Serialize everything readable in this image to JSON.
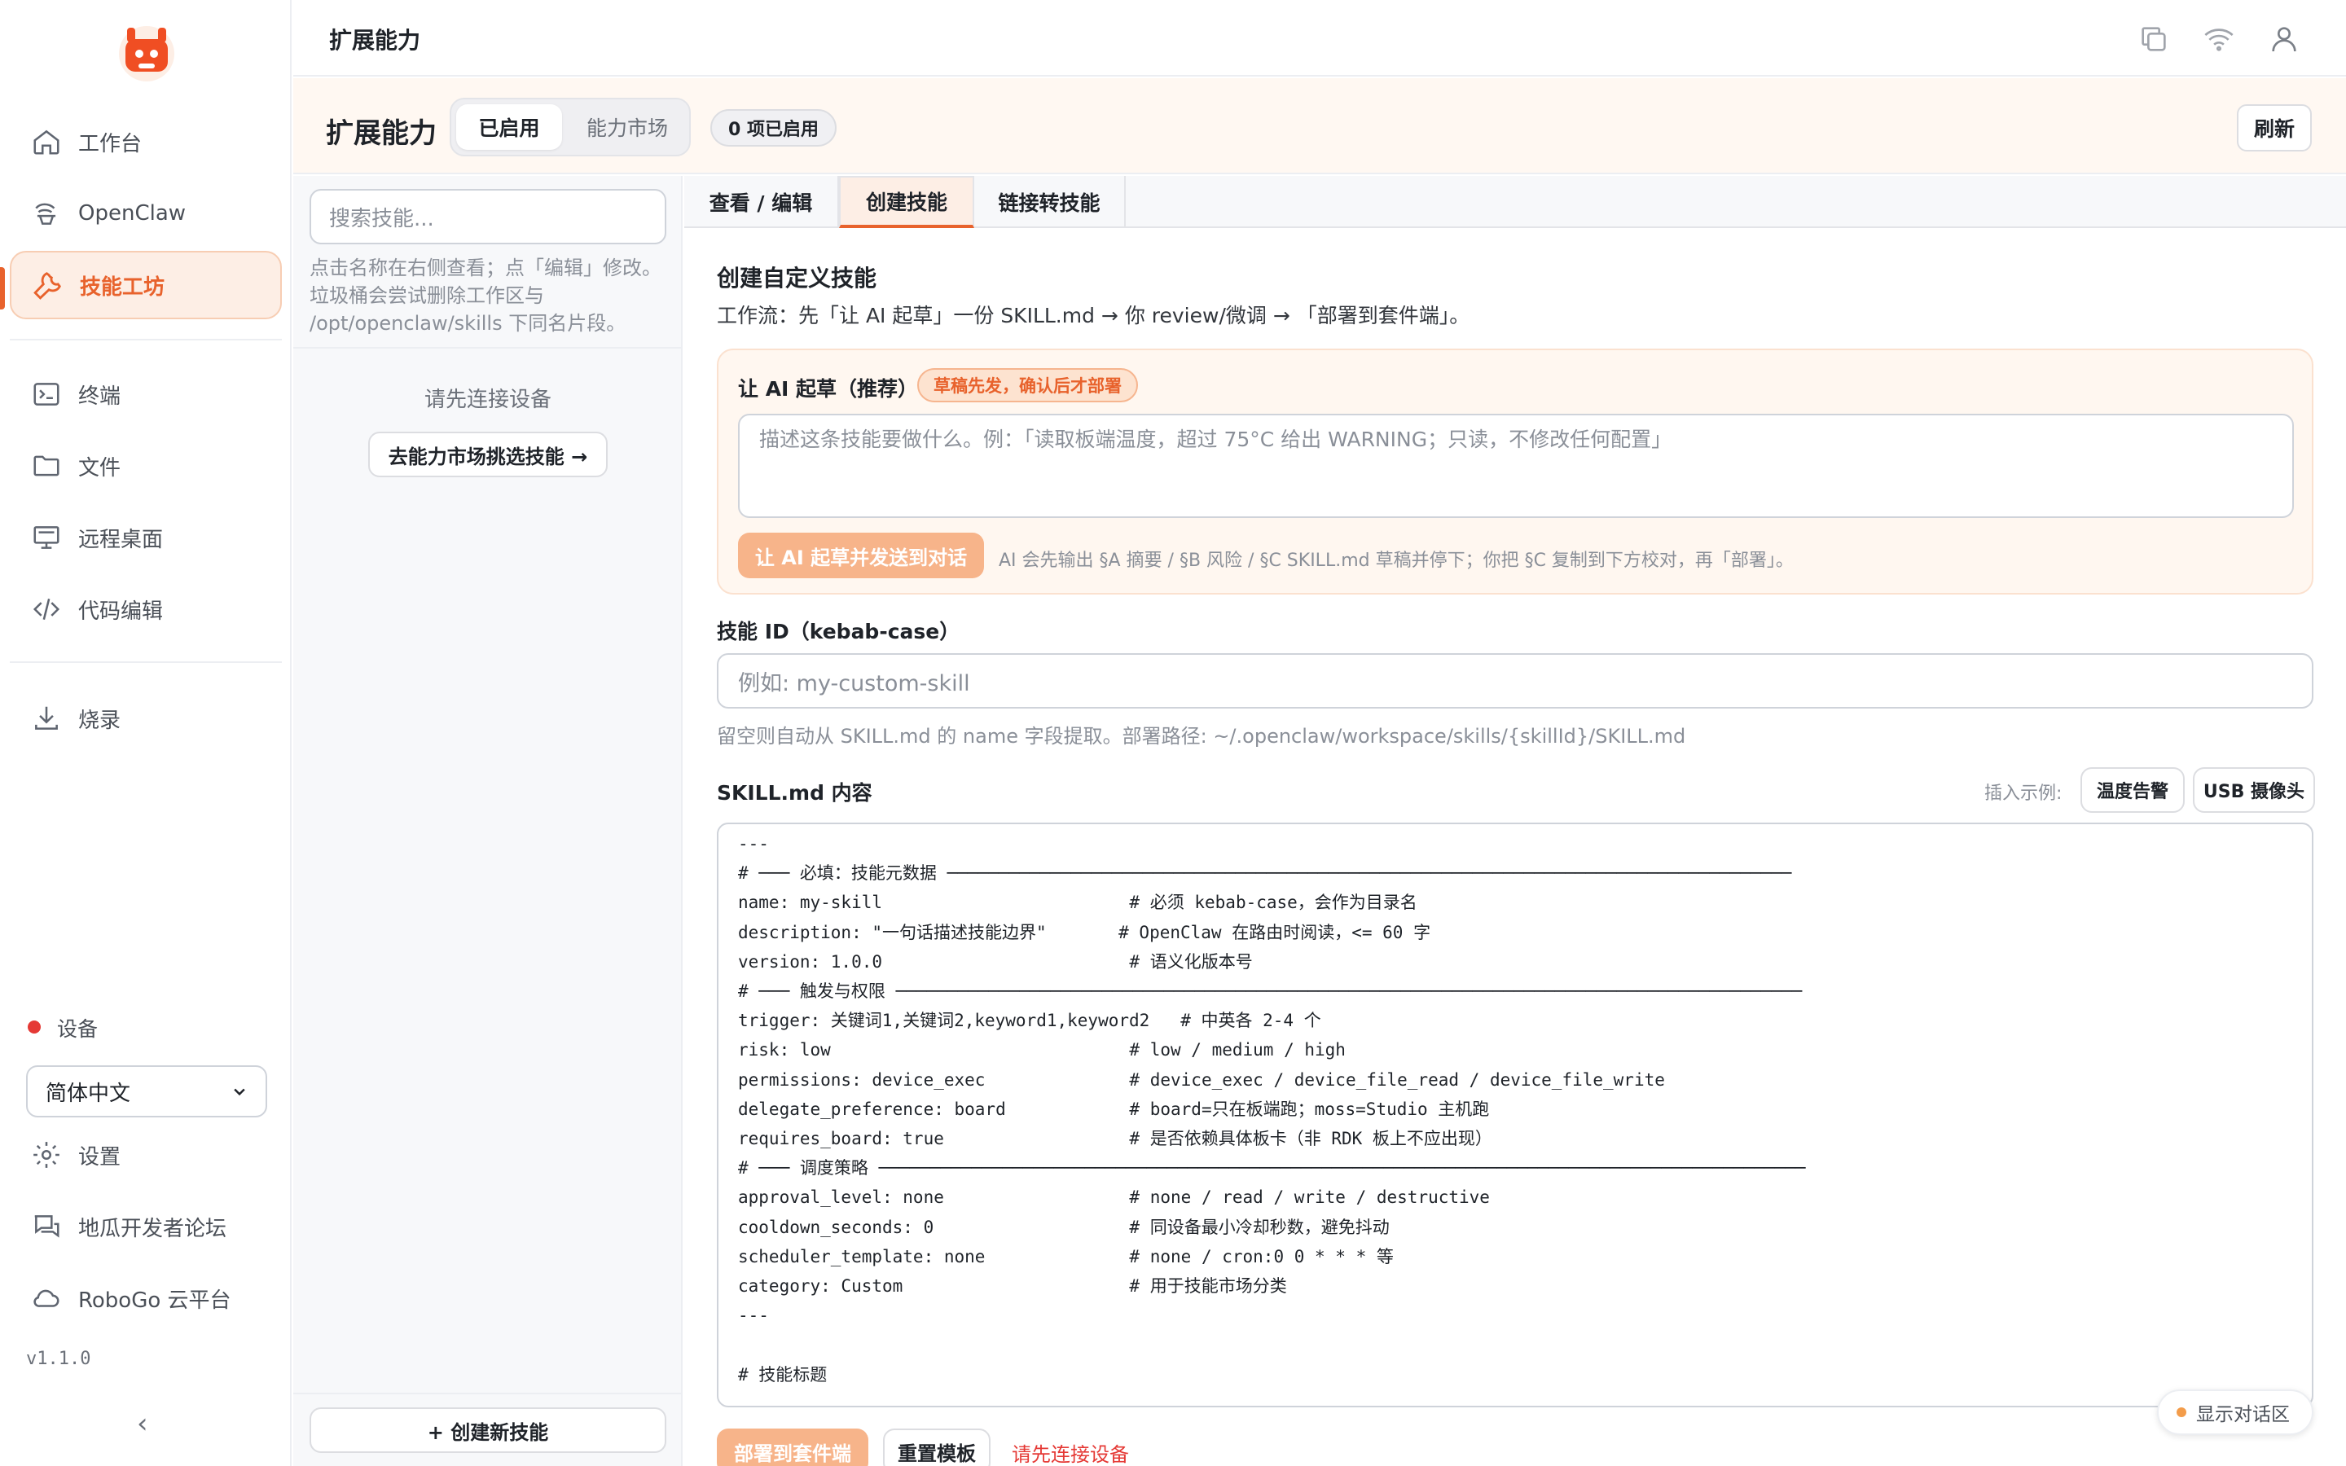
{
  "sidebar": {
    "nav": [
      "工作台",
      "OpenClaw",
      "技能工坊",
      "终端",
      "文件",
      "远程桌面",
      "代码编辑",
      "烧录"
    ],
    "device_label": "设备",
    "language": "简体中文",
    "bottom": [
      "设置",
      "地瓜开发者论坛",
      "RoboGo 云平台"
    ],
    "version": "v1.1.0"
  },
  "topbar": {
    "title": "扩展能力"
  },
  "page_header": {
    "title": "扩展能力",
    "tabs": [
      "已启用",
      "能力市场"
    ],
    "count_badge": "0 项已启用",
    "refresh_label": "刷新"
  },
  "skill_list": {
    "search_placeholder": "搜索技能...",
    "hint": "点击名称在右侧查看；点「编辑」修改。垃圾桶会尝试删除工作区与 /opt/openclaw/skills 下同名片段。",
    "connect_msg": "请先连接设备",
    "market_button": "去能力市场挑选技能 →",
    "new_skill": "+ 创建新技能"
  },
  "main": {
    "tabs": [
      "查看 / 编辑",
      "创建技能",
      "链接转技能"
    ],
    "section_title": "创建自定义技能",
    "workflow": "工作流：先「让 AI 起草」一份 SKILL.md → 你 review/微调 → 「部署到套件端」。",
    "ai_draft": {
      "label": "让 AI 起草（推荐）",
      "tag": "草稿先发，确认后才部署",
      "placeholder": "描述这条技能要做什么。例：「读取板端温度，超过 75°C 给出 WARNING；只读，不修改任何配置」",
      "button": "让 AI 起草并发送到对话",
      "note": "AI 会先输出 §A 摘要 / §B 风险 / §C SKILL.md 草稿并停下；你把 §C 复制到下方校对，再「部署」。"
    },
    "skill_id": {
      "label": "技能 ID（kebab-case）",
      "placeholder": "例如: my-custom-skill",
      "hint": "留空则自动从 SKILL.md 的 name 字段提取。部署路径: ~/.openclaw/workspace/skills/{skillId}/SKILL.md"
    },
    "skill_md": {
      "label": "SKILL.md 内容",
      "insert_label": "插入示例:",
      "examples": [
        "温度告警",
        "USB 摄像头"
      ],
      "content": "---\n# ─── 必填：技能元数据 ──────────────────────────────────────────────────────────────────────────────────\nname: my-skill                        # 必须 kebab-case，会作为目录名\ndescription: \"一句话描述技能边界\"       # OpenClaw 在路由时阅读，<= 60 字\nversion: 1.0.0                        # 语义化版本号\n# ─── 触发与权限 ────────────────────────────────────────────────────────────────────────────────────────\ntrigger: 关键词1,关键词2,keyword1,keyword2   # 中英各 2-4 个\nrisk: low                             # low / medium / high\npermissions: device_exec              # device_exec / device_file_read / device_file_write\ndelegate_preference: board            # board=只在板端跑；moss=Studio 主机跑\nrequires_board: true                  # 是否依赖具体板卡（非 RDK 板上不应出现）\n# ─── 调度策略 ──────────────────────────────────────────────────────────────────────────────────────────\napproval_level: none                  # none / read / write / destructive\ncooldown_seconds: 0                   # 同设备最小冷却秒数，避免抖动\nscheduler_template: none              # none / cron:0 0 * * * 等\ncategory: Custom                      # 用于技能市场分类\n---\n\n# 技能标题"
    },
    "deploy_button": "部署到套件端",
    "reset_button": "重置模板",
    "warning": "请先连接设备"
  },
  "chat_toggle": "显示对话区",
  "colors": {
    "accent": "#e8622c",
    "device_status": "#e53935"
  }
}
